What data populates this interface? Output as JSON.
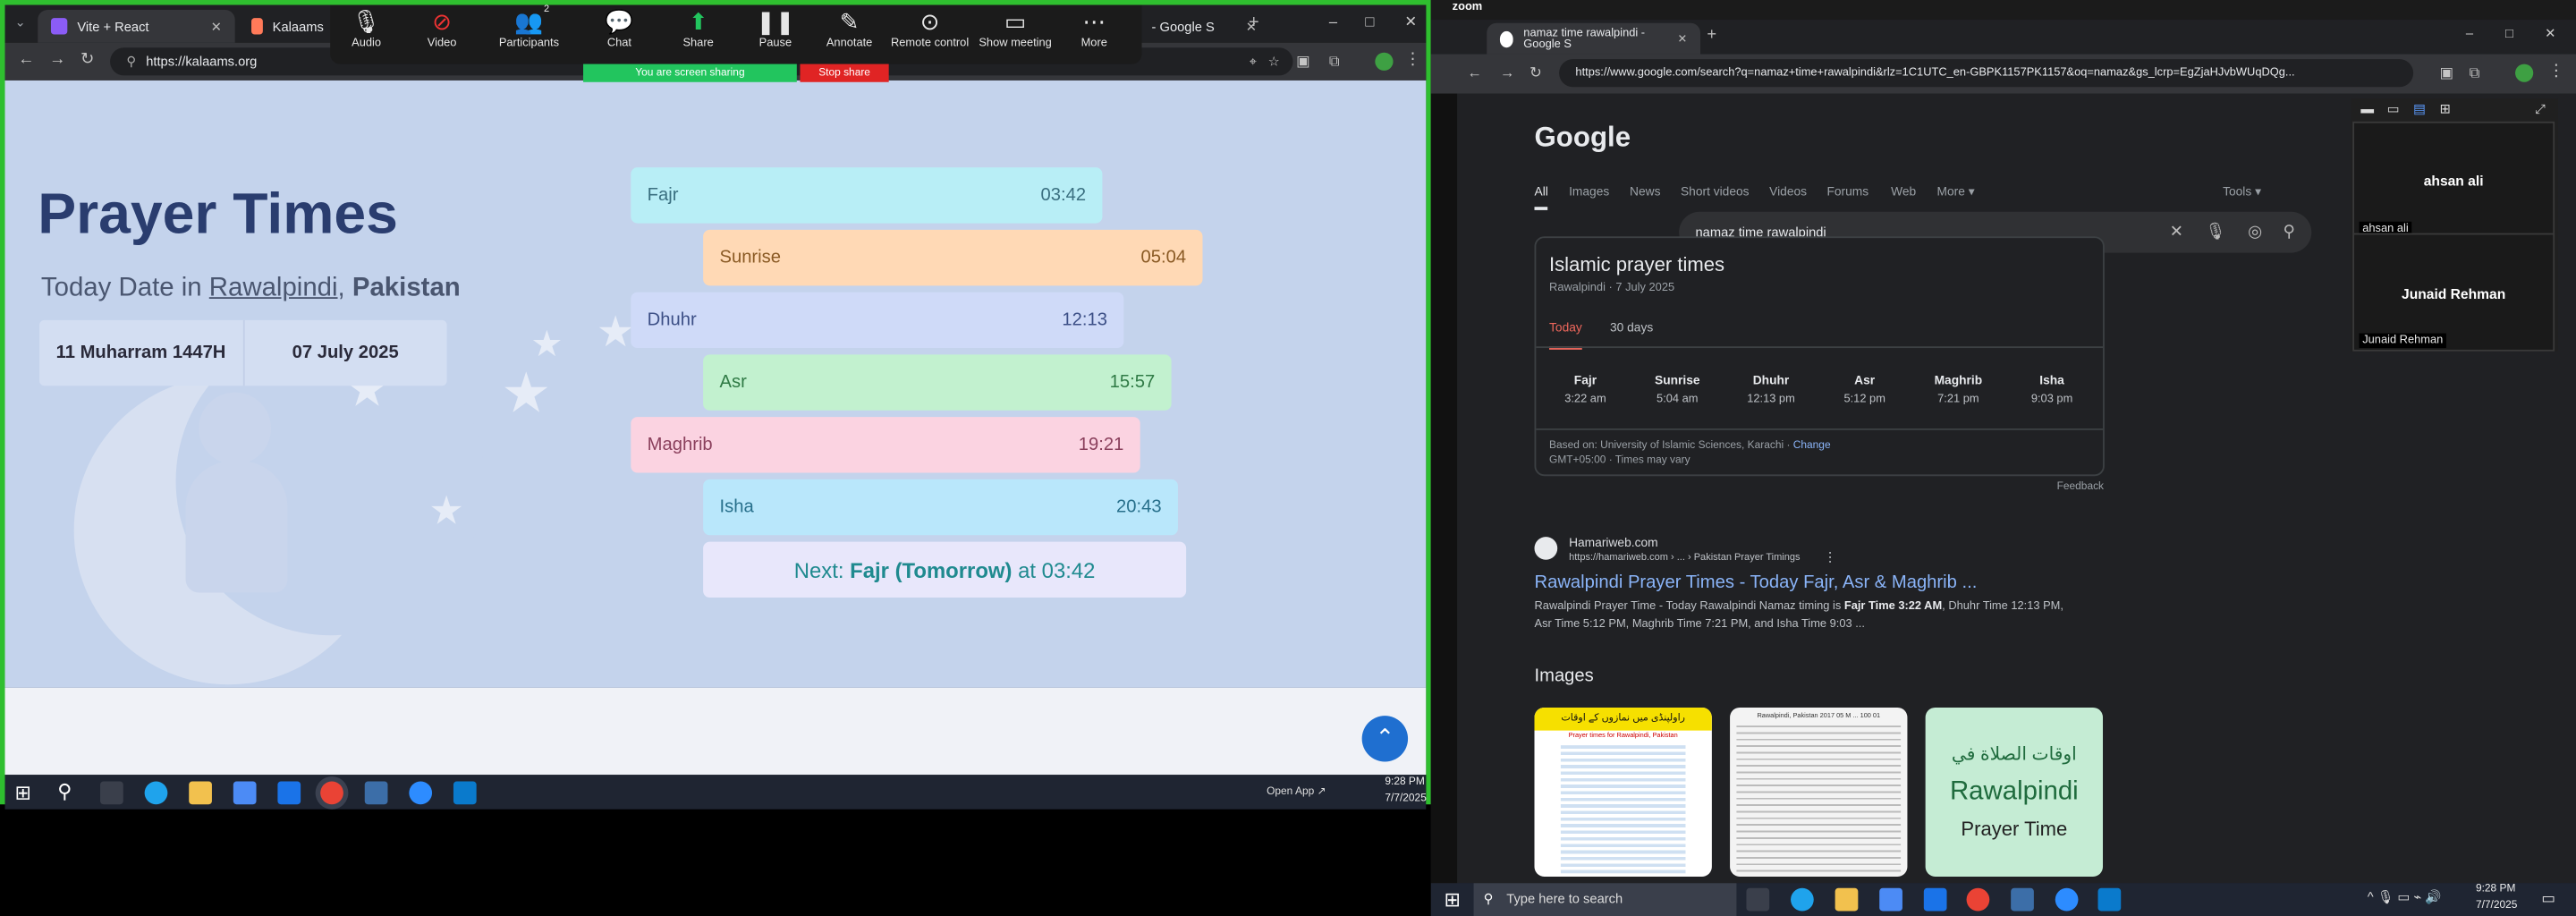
{
  "left_browser": {
    "tabs": [
      {
        "label": "Vite + React",
        "active": true
      },
      {
        "label": "Kalaams"
      },
      {
        "label": "- Google S"
      }
    ],
    "new_tab": "+",
    "url": "https://kalaams.org",
    "window_controls": [
      "–",
      "□",
      "✕"
    ]
  },
  "zoom_toolbar": {
    "items": [
      {
        "label": "Audio",
        "icon": "microphone-icon"
      },
      {
        "label": "Video",
        "icon": "video-off-icon"
      },
      {
        "label": "Participants",
        "icon": "participants-icon",
        "count": "2"
      },
      {
        "label": "Chat",
        "icon": "chat-icon"
      },
      {
        "label": "Share",
        "icon": "share-icon"
      },
      {
        "label": "Pause",
        "icon": "pause-icon"
      },
      {
        "label": "Annotate",
        "icon": "annotate-icon"
      },
      {
        "label": "Remote control",
        "icon": "remote-control-icon"
      },
      {
        "label": "Show meeting",
        "icon": "show-meeting-icon"
      },
      {
        "label": "More",
        "icon": "more-icon"
      }
    ],
    "sharing_text": "You are screen sharing",
    "stop_share": "Stop share"
  },
  "prayer_page": {
    "title": "Prayer Times",
    "subtitle_prefix": "Today Date in ",
    "city": "Rawalpindi",
    "sep": ", ",
    "country": "Pakistan",
    "hijri_date": "11 Muharram 1447H",
    "greg_date": "07 July 2025",
    "prayers": [
      {
        "name": "Fajr",
        "time": "03:42",
        "color": "#b8eef6",
        "text": "#3a6f80"
      },
      {
        "name": "Sunrise",
        "time": "05:04",
        "color": "#ffd9b5",
        "text": "#8a5a24"
      },
      {
        "name": "Dhuhr",
        "time": "12:13",
        "color": "#cfdaf8",
        "text": "#3c4f86"
      },
      {
        "name": "Asr",
        "time": "15:57",
        "color": "#c2f1cf",
        "text": "#2f7a45"
      },
      {
        "name": "Maghrib",
        "time": "19:21",
        "color": "#fbd3e1",
        "text": "#8a3f5c"
      },
      {
        "name": "Isha",
        "time": "20:43",
        "color": "#b9e7fb",
        "text": "#28708c"
      }
    ],
    "next_prefix": "Next: ",
    "next_name": "Fajr (Tomorrow)",
    "next_mid": " at ",
    "next_time": "03:42"
  },
  "left_taskbar": {
    "open_app": "Open App ↗",
    "time": "9:28 PM",
    "date": "7/7/2025"
  },
  "right_browser": {
    "zoom_label": "zoom",
    "tab": "namaz time rawalpindi - Google S",
    "url": "https://www.google.com/search?q=namaz+time+rawalpindi&rlz=1C1UTC_en-GBPK1157PK1157&oq=namaz&gs_lcrp=EgZjaHJvbWUqDQg...",
    "search_query": "namaz time rawalpindi",
    "logo": "Google",
    "nav": [
      "All",
      "Images",
      "News",
      "Short videos",
      "Videos",
      "Forums",
      "Web",
      "More ▾"
    ],
    "tools": "Tools ▾",
    "card": {
      "title": "Islamic prayer times",
      "subtitle": "Rawalpindi · 7 July 2025",
      "tabs": [
        "Today",
        "30 days"
      ],
      "times": [
        {
          "n": "Fajr",
          "t": "3:22 am"
        },
        {
          "n": "Sunrise",
          "t": "5:04 am"
        },
        {
          "n": "Dhuhr",
          "t": "12:13 pm"
        },
        {
          "n": "Asr",
          "t": "5:12 pm"
        },
        {
          "n": "Maghrib",
          "t": "7:21 pm"
        },
        {
          "n": "Isha",
          "t": "9:03 pm"
        }
      ],
      "based_on": "Based on: University of Islamic Sciences, Karachi · ",
      "change": "Change",
      "gmt": "GMT+05:00 · Times may vary"
    },
    "feedback": "Feedback",
    "result": {
      "site": "Hamariweb.com",
      "path": "https://hamariweb.com › ... › Pakistan Prayer Timings",
      "title": "Rawalpindi Prayer Times - Today Fajr, Asr & Maghrib ...",
      "snippet1a": "Rawalpindi Prayer Time - Today Rawalpindi Namaz timing is ",
      "snippet1b": "Fajr Time 3:22 AM",
      "snippet1c": ", Dhuhr Time 12:13 PM,",
      "snippet2": "Asr Time 5:12 PM, Maghrib Time 7:21 PM, and Isha Time 9:03 ..."
    },
    "images_heading": "Images",
    "image3_line1": "اوقات الصلاة في",
    "image3_line2": "Rawalpindi",
    "image3_line3": "Prayer Time",
    "image1_top": "راولپنڈی میں نمازوں کے اوقات",
    "image1_sub": "Prayer times for Rawalpindi, Pakistan",
    "image2_top": "Rawalpindi, Pakistan 2017 05 M ... 100 01"
  },
  "participants": [
    {
      "name": "ahsan ali",
      "tag": "ahsan ali"
    },
    {
      "name": "Junaid Rehman",
      "tag": "Junaid Rehman"
    }
  ],
  "right_taskbar": {
    "search_placeholder": "Type here to search",
    "time": "9:28 PM",
    "date": "7/7/2025"
  }
}
